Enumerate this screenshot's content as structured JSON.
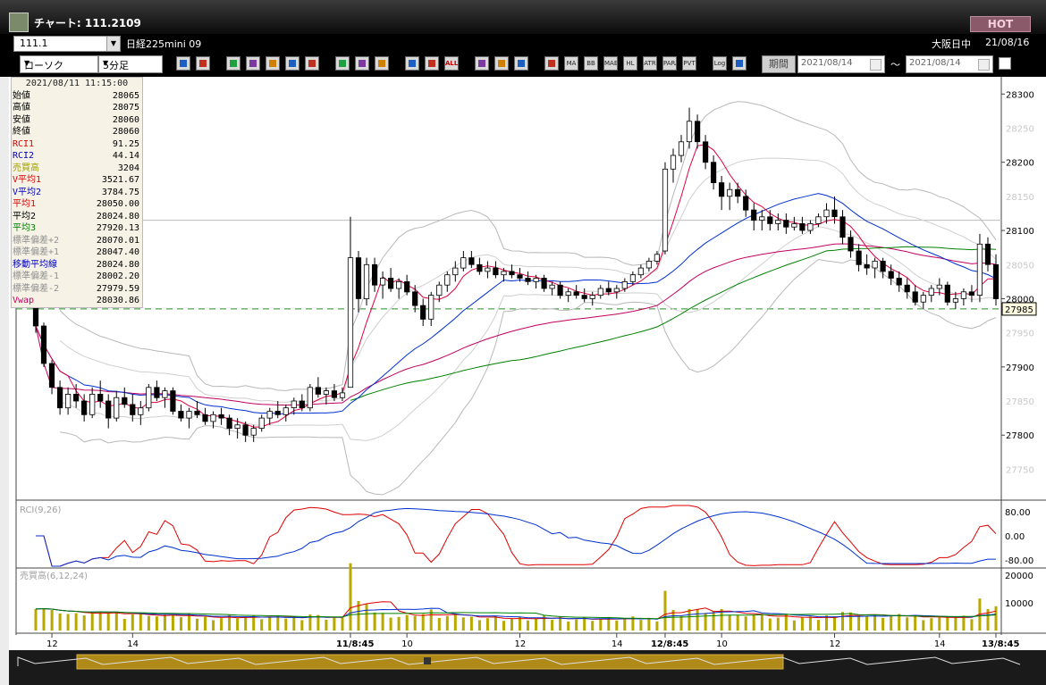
{
  "window": {
    "title": "チャート: 111.2109",
    "hot_label": "HOT"
  },
  "symbol_bar": {
    "code": "111.1",
    "name": "日経225mini 09",
    "market": "大阪日中",
    "date": "21/08/16"
  },
  "toolbar": {
    "chart_type": "ローソク",
    "interval": "5分足",
    "period_label": "期間",
    "date_from": "2021/08/14",
    "date_to": "2021/08/14",
    "tilde": "〜",
    "buttons": [
      {
        "name": "zoom",
        "text": "",
        "icon": "magnifier"
      },
      {
        "name": "layout",
        "text": "",
        "icon": "table"
      },
      {
        "name": "down-arrow",
        "text": "",
        "icon": "down"
      },
      {
        "name": "search",
        "text": "",
        "icon": "search"
      },
      {
        "name": "candle-pair",
        "text": "",
        "icon": "candles"
      },
      {
        "name": "volume",
        "text": "",
        "icon": "bars"
      },
      {
        "name": "blank",
        "text": "",
        "icon": "blank"
      },
      {
        "name": "pen",
        "text": "",
        "icon": "pen"
      },
      {
        "name": "cursor",
        "text": "",
        "icon": "cursor"
      },
      {
        "name": "arrow",
        "text": "",
        "icon": "arrow"
      },
      {
        "name": "candle-a",
        "text": "",
        "icon": "candle"
      },
      {
        "name": "candle-b",
        "text": "",
        "icon": "candle"
      },
      {
        "name": "all",
        "text": "ALL",
        "icon": "text"
      },
      {
        "name": "palette",
        "text": "",
        "icon": "palette"
      },
      {
        "name": "brush",
        "text": "",
        "icon": "brush"
      },
      {
        "name": "color",
        "text": "",
        "icon": "color"
      },
      {
        "name": "multi",
        "text": "",
        "icon": "grid"
      },
      {
        "name": "ma",
        "text": "MA",
        "icon": "text"
      },
      {
        "name": "bb",
        "text": "BB",
        "icon": "text"
      },
      {
        "name": "mae",
        "text": "MAE",
        "icon": "text"
      },
      {
        "name": "hl",
        "text": "HL",
        "icon": "text"
      },
      {
        "name": "atr",
        "text": "ATR",
        "icon": "text"
      },
      {
        "name": "para",
        "text": "PARA",
        "icon": "text"
      },
      {
        "name": "pvt",
        "text": "PVT",
        "icon": "text"
      },
      {
        "name": "log",
        "text": "Log",
        "icon": "text"
      },
      {
        "name": "window",
        "text": "",
        "icon": "window"
      }
    ]
  },
  "info_panel": {
    "datetime": "2021/08/11 11:15:00",
    "rows": [
      {
        "label": "始値",
        "value": "28065",
        "color": "#000000"
      },
      {
        "label": "高値",
        "value": "28075",
        "color": "#000000"
      },
      {
        "label": "安値",
        "value": "28060",
        "color": "#000000"
      },
      {
        "label": "終値",
        "value": "28060",
        "color": "#000000"
      },
      {
        "label": "RCI1",
        "value": "91.25",
        "color": "#e00000"
      },
      {
        "label": "RCI2",
        "value": "44.14",
        "color": "#0000c0"
      },
      {
        "label": "売買高",
        "value": "3204",
        "color": "#a0a000"
      },
      {
        "label": "V平均1",
        "value": "3521.67",
        "color": "#e00000"
      },
      {
        "label": "V平均2",
        "value": "3784.75",
        "color": "#0000c0"
      },
      {
        "label": "平均1",
        "value": "28050.00",
        "color": "#e00000"
      },
      {
        "label": "平均2",
        "value": "28024.80",
        "color": "#000000"
      },
      {
        "label": "平均3",
        "value": "27920.13",
        "color": "#008000"
      },
      {
        "label": "標準偏差+2",
        "value": "28070.01",
        "color": "#909090"
      },
      {
        "label": "標準偏差+1",
        "value": "28047.40",
        "color": "#909090"
      },
      {
        "label": "移動平均線",
        "value": "28024.80",
        "color": "#0000c0"
      },
      {
        "label": "標準偏差-1",
        "value": "28002.20",
        "color": "#909090"
      },
      {
        "label": "標準偏差-2",
        "value": "27979.59",
        "color": "#909090"
      },
      {
        "label": "Vwap",
        "value": "28030.86",
        "color": "#c00060"
      }
    ]
  },
  "price_axis": {
    "ticks": [
      "28300",
      "28200",
      "28100",
      "28000",
      "27900",
      "27800"
    ],
    "minor_ticks": [
      "28250",
      "28150",
      "28050",
      "27950",
      "27850",
      "27750",
      "27700"
    ],
    "current_price": "27985"
  },
  "rci_panel": {
    "label": "RCI(9,26)",
    "ticks": [
      "80.00",
      "0.00",
      "-80.00"
    ]
  },
  "volume_panel": {
    "label": "売買高(6,12,24)",
    "ticks": [
      "20000",
      "10000"
    ]
  },
  "time_axis": {
    "labels": [
      "12",
      "14",
      "11/8:45",
      "10",
      "12",
      "14",
      "12/8:45",
      "10",
      "12",
      "14",
      "13/8:45"
    ]
  },
  "chart_data": {
    "type": "candlestick",
    "interval": "5分足",
    "ylim": [
      27710,
      28320
    ],
    "current_price": 27985,
    "candles": [
      [
        28005,
        28020,
        27950,
        27960
      ],
      [
        27960,
        27965,
        27900,
        27905
      ],
      [
        27905,
        27910,
        27860,
        27870
      ],
      [
        27870,
        27880,
        27830,
        27840
      ],
      [
        27840,
        27870,
        27830,
        27860
      ],
      [
        27860,
        27875,
        27840,
        27850
      ],
      [
        27850,
        27860,
        27820,
        27830
      ],
      [
        27830,
        27870,
        27825,
        27860
      ],
      [
        27860,
        27880,
        27840,
        27850
      ],
      [
        27850,
        27860,
        27810,
        27825
      ],
      [
        27825,
        27865,
        27820,
        27855
      ],
      [
        27855,
        27870,
        27840,
        27845
      ],
      [
        27845,
        27860,
        27820,
        27830
      ],
      [
        27830,
        27850,
        27815,
        27840
      ],
      [
        27840,
        27875,
        27835,
        27870
      ],
      [
        27870,
        27880,
        27850,
        27855
      ],
      [
        27855,
        27870,
        27840,
        27865
      ],
      [
        27865,
        27870,
        27830,
        27835
      ],
      [
        27835,
        27845,
        27820,
        27825
      ],
      [
        27825,
        27840,
        27810,
        27835
      ],
      [
        27835,
        27850,
        27825,
        27830
      ],
      [
        27830,
        27840,
        27815,
        27820
      ],
      [
        27820,
        27835,
        27810,
        27830
      ],
      [
        27830,
        27840,
        27815,
        27825
      ],
      [
        27825,
        27830,
        27800,
        27810
      ],
      [
        27810,
        27825,
        27795,
        27815
      ],
      [
        27815,
        27820,
        27790,
        27800
      ],
      [
        27800,
        27815,
        27790,
        27810
      ],
      [
        27810,
        27830,
        27805,
        27825
      ],
      [
        27825,
        27840,
        27815,
        27835
      ],
      [
        27835,
        27850,
        27825,
        27830
      ],
      [
        27830,
        27845,
        27820,
        27840
      ],
      [
        27840,
        27855,
        27830,
        27850
      ],
      [
        27850,
        27860,
        27835,
        27840
      ],
      [
        27840,
        27875,
        27835,
        27870
      ],
      [
        27870,
        27885,
        27855,
        27860
      ],
      [
        27860,
        27870,
        27845,
        27865
      ],
      [
        27865,
        27875,
        27850,
        27855
      ],
      [
        27855,
        27870,
        27850,
        27862
      ],
      [
        27870,
        28120,
        27870,
        28060
      ],
      [
        28060,
        28070,
        27980,
        28000
      ],
      [
        28000,
        28060,
        27990,
        28050
      ],
      [
        28050,
        28060,
        28010,
        28020
      ],
      [
        28020,
        28040,
        28000,
        28030
      ],
      [
        28030,
        28045,
        28010,
        28015
      ],
      [
        28015,
        28030,
        28000,
        28025
      ],
      [
        28025,
        28035,
        28005,
        28010
      ],
      [
        28010,
        28020,
        27980,
        27990
      ],
      [
        27990,
        28000,
        27960,
        27970
      ],
      [
        27970,
        28010,
        27960,
        28005
      ],
      [
        28005,
        28025,
        27995,
        28020
      ],
      [
        28020,
        28040,
        28010,
        28035
      ],
      [
        28035,
        28055,
        28025,
        28045
      ],
      [
        28045,
        28070,
        28040,
        28060
      ],
      [
        28060,
        28070,
        28045,
        28050
      ],
      [
        28050,
        28060,
        28035,
        28040
      ],
      [
        28040,
        28055,
        28030,
        28045
      ],
      [
        28045,
        28055,
        28030,
        28035
      ],
      [
        28035,
        28045,
        28025,
        28040
      ],
      [
        28040,
        28050,
        28030,
        28035
      ],
      [
        28035,
        28045,
        28025,
        28030
      ],
      [
        28030,
        28040,
        28020,
        28025
      ],
      [
        28025,
        28035,
        28015,
        28030
      ],
      [
        28030,
        28035,
        28010,
        28015
      ],
      [
        28015,
        28025,
        28005,
        28020
      ],
      [
        28020,
        28025,
        28000,
        28005
      ],
      [
        28005,
        28015,
        27995,
        28010
      ],
      [
        28010,
        28020,
        28000,
        28005
      ],
      [
        28005,
        28015,
        27995,
        28000
      ],
      [
        28000,
        28010,
        27990,
        28005
      ],
      [
        28005,
        28020,
        28000,
        28015
      ],
      [
        28015,
        28025,
        28005,
        28010
      ],
      [
        28010,
        28020,
        28000,
        28015
      ],
      [
        28015,
        28030,
        28010,
        28025
      ],
      [
        28025,
        28040,
        28020,
        28035
      ],
      [
        28035,
        28050,
        28030,
        28045
      ],
      [
        28045,
        28060,
        28040,
        28055
      ],
      [
        28055,
        28070,
        28050,
        28065
      ],
      [
        28070,
        28200,
        28065,
        28190
      ],
      [
        28190,
        28220,
        28170,
        28210
      ],
      [
        28210,
        28240,
        28200,
        28230
      ],
      [
        28230,
        28280,
        28220,
        28260
      ],
      [
        28260,
        28270,
        28220,
        28230
      ],
      [
        28230,
        28240,
        28190,
        28200
      ],
      [
        28200,
        28210,
        28160,
        28170
      ],
      [
        28170,
        28180,
        28130,
        28150
      ],
      [
        28150,
        28170,
        28130,
        28160
      ],
      [
        28160,
        28170,
        28140,
        28150
      ],
      [
        28150,
        28160,
        28120,
        28130
      ],
      [
        28130,
        28140,
        28100,
        28115
      ],
      [
        28115,
        28130,
        28100,
        28120
      ],
      [
        28120,
        28130,
        28100,
        28110
      ],
      [
        28110,
        28125,
        28100,
        28115
      ],
      [
        28115,
        28125,
        28095,
        28105
      ],
      [
        28105,
        28120,
        28100,
        28110
      ],
      [
        28110,
        28120,
        28095,
        28100
      ],
      [
        28100,
        28115,
        28095,
        28110
      ],
      [
        28110,
        28125,
        28105,
        28120
      ],
      [
        28120,
        28140,
        28110,
        28130
      ],
      [
        28130,
        28150,
        28110,
        28120
      ],
      [
        28120,
        28130,
        28080,
        28090
      ],
      [
        28090,
        28100,
        28060,
        28070
      ],
      [
        28070,
        28080,
        28040,
        28050
      ],
      [
        28050,
        28065,
        28035,
        28045
      ],
      [
        28045,
        28060,
        28030,
        28055
      ],
      [
        28055,
        28060,
        28030,
        28040
      ],
      [
        28040,
        28050,
        28020,
        28030
      ],
      [
        28030,
        28040,
        28010,
        28020
      ],
      [
        28020,
        28030,
        28000,
        28010
      ],
      [
        28010,
        28020,
        27990,
        27995
      ],
      [
        27995,
        28010,
        27985,
        28005
      ],
      [
        28005,
        28020,
        27995,
        28015
      ],
      [
        28015,
        28030,
        28005,
        28020
      ],
      [
        28020,
        28025,
        27990,
        27995
      ],
      [
        27995,
        28010,
        27985,
        28000
      ],
      [
        28000,
        28015,
        27990,
        28010
      ],
      [
        28010,
        28020,
        27995,
        28005
      ],
      [
        28005,
        28095,
        27995,
        28080
      ],
      [
        28080,
        28090,
        28040,
        28050
      ],
      [
        28050,
        28065,
        27990,
        28000
      ]
    ],
    "series": [
      {
        "name": "平均1",
        "color": "#e00040"
      },
      {
        "name": "平均2",
        "color": "#0030d0"
      },
      {
        "name": "平均3",
        "color": "#008000"
      },
      {
        "name": "Vwap",
        "color": "#c00060"
      },
      {
        "name": "標準偏差+2",
        "color": "#b0b0b0"
      },
      {
        "name": "標準偏差+1",
        "color": "#b0b0b0"
      },
      {
        "name": "標準偏差-1",
        "color": "#b0b0b0"
      },
      {
        "name": "標準偏差-2",
        "color": "#b0b0b0"
      }
    ],
    "rci": {
      "short_period": 9,
      "long_period": 26,
      "ylim": [
        -100,
        100
      ]
    },
    "volume": {
      "periods": [
        6,
        12,
        24
      ],
      "ylim": [
        0,
        22000
      ]
    }
  }
}
